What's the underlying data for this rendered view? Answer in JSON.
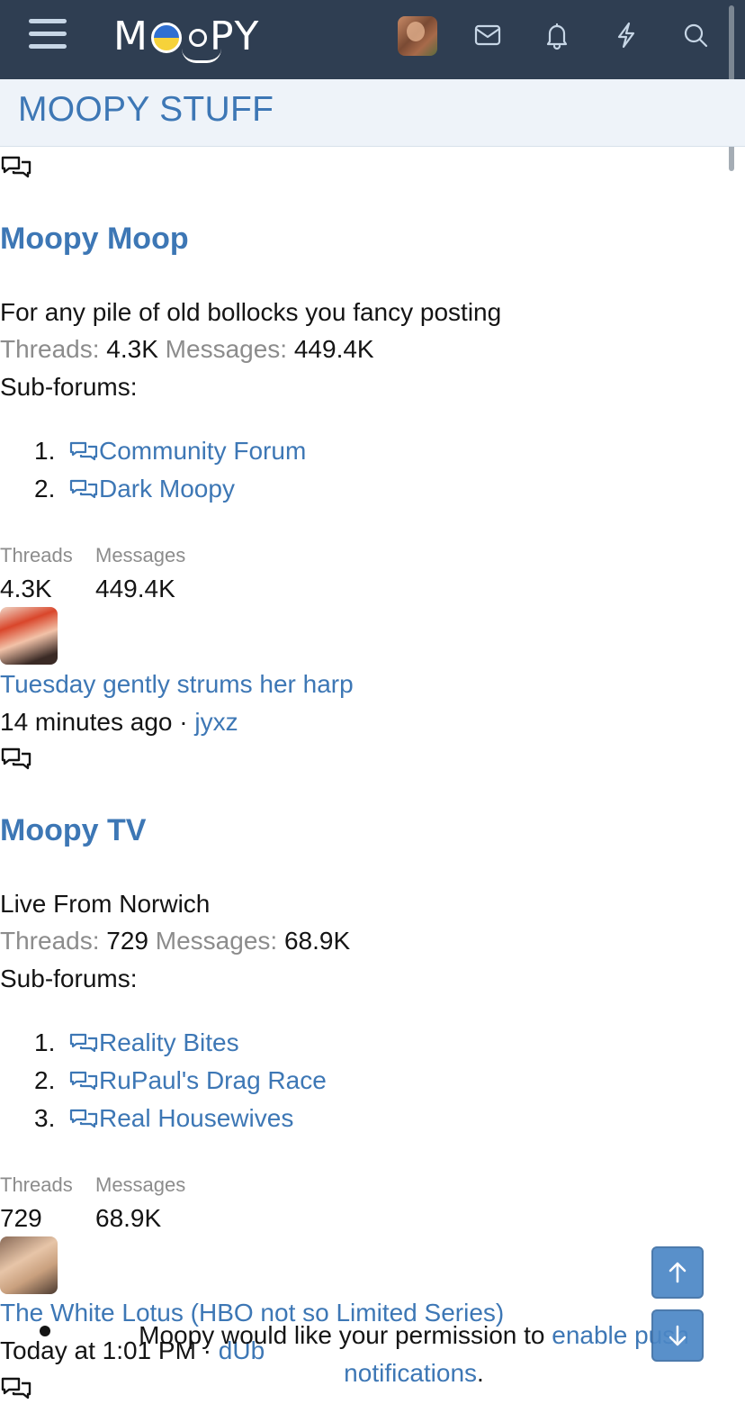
{
  "header": {
    "logo_text": "MOOPY",
    "icons": [
      "menu-icon",
      "inbox-icon",
      "bell-icon",
      "bolt-icon",
      "search-icon"
    ]
  },
  "page_title": "MOOPY STUFF",
  "forums": [
    {
      "title": "Moopy Moop",
      "description": "For any pile of old bollocks you fancy posting",
      "threads_label": "Threads:",
      "threads": "4.3K",
      "messages_label": "Messages:",
      "messages": "449.4K",
      "subforums_label": "Sub-forums:",
      "subforums": [
        {
          "num": "1.",
          "label": "Community Forum"
        },
        {
          "num": "2.",
          "label": "Dark Moopy"
        }
      ],
      "mini_threads_label": "Threads",
      "mini_messages_label": "Messages",
      "latest_title": "Tuesday gently strums her harp",
      "latest_time": "14 minutes ago",
      "latest_sep": " · ",
      "latest_user": "jyxz"
    },
    {
      "title": "Moopy TV",
      "description": "Live From Norwich",
      "threads_label": "Threads:",
      "threads": "729",
      "messages_label": "Messages:",
      "messages": "68.9K",
      "subforums_label": "Sub-forums:",
      "subforums": [
        {
          "num": "1.",
          "label": "Reality Bites"
        },
        {
          "num": "2.",
          "label": "RuPaul's Drag Race"
        },
        {
          "num": "3.",
          "label": "Real Housewives"
        }
      ],
      "mini_threads_label": "Threads",
      "mini_messages_label": "Messages",
      "latest_title": "The White Lotus (HBO not so Limited Series)",
      "latest_time": "Today at 1:01 PM",
      "latest_sep": " · ",
      "latest_user": "dUb"
    }
  ],
  "push_notice": {
    "text_before": "Moopy would like your permission to ",
    "link": "enable push notifications",
    "text_after": "."
  },
  "colors": {
    "nav_bg": "#2f3e52",
    "link": "#3d77b5",
    "title_band": "#eef3f9"
  }
}
